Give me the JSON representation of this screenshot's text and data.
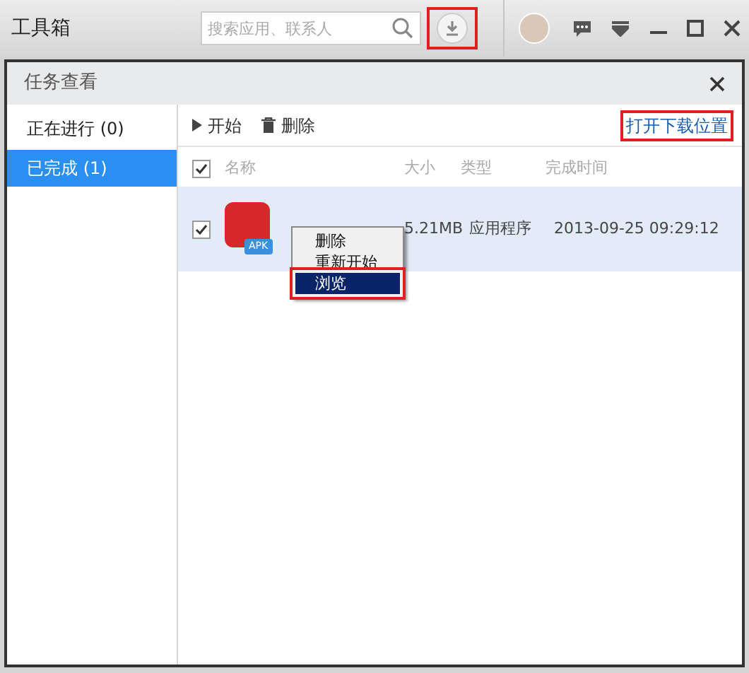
{
  "app_bar": {
    "title": "工具箱",
    "search": {
      "placeholder": "搜索应用、联系人"
    }
  },
  "dialog": {
    "title": "任务查看",
    "sidebar": {
      "items": [
        {
          "label": "正在进行 (0)",
          "selected": false
        },
        {
          "label": "已完成 (1)",
          "selected": true
        }
      ]
    },
    "toolbar": {
      "buttons": [
        {
          "label": "开始",
          "kind": "play"
        },
        {
          "label": "删除",
          "kind": "trash"
        }
      ],
      "link": "打开下载位置"
    },
    "table": {
      "all_checked": true,
      "columns": [
        "名称",
        "大小",
        "类型",
        "完成时间"
      ],
      "rows": [
        {
          "checked": true,
          "selected": true,
          "icon_badge": "APK",
          "size": "5.21MB",
          "type": "应用程序",
          "time": "2013-09-25 09:29:12"
        }
      ]
    },
    "context_menu": {
      "items": [
        {
          "label": "删除",
          "selected": false
        },
        {
          "label": "重新开始",
          "selected": false
        },
        {
          "label": "浏览",
          "selected": true
        }
      ]
    }
  }
}
